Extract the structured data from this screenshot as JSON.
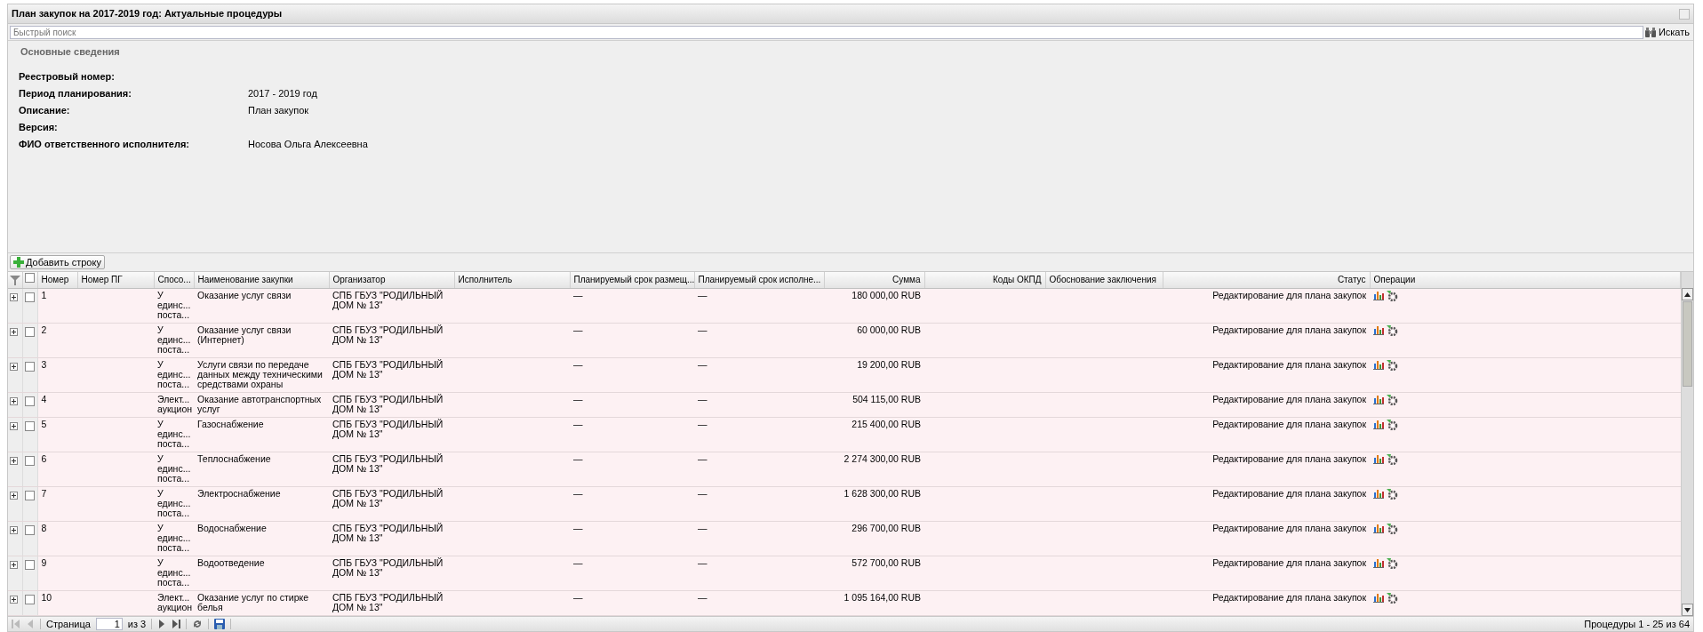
{
  "window": {
    "title": "План закупок на 2017-2019 год: Актуальные процедуры"
  },
  "search": {
    "placeholder": "Быстрый поиск",
    "button": "Искать"
  },
  "info": {
    "section": "Основные сведения",
    "fields": [
      {
        "label": "Реестровый номер:"
      },
      {
        "label": "Период планирования:",
        "value": "2017 - 2019 год"
      },
      {
        "label": "Описание:",
        "value": "План закупок"
      },
      {
        "label": "Версия:"
      },
      {
        "label": "ФИО ответственного исполнителя:",
        "value": "Носова Ольга Алексеевна"
      }
    ]
  },
  "toolbar": {
    "add_button": "Добавить строку"
  },
  "table": {
    "header_checked": false,
    "columns": [
      {
        "label": "Номер"
      },
      {
        "label": "Номер ПГ"
      },
      {
        "label": "Спосо..."
      },
      {
        "label": "Наименование закупки"
      },
      {
        "label": "Организатор"
      },
      {
        "label": "Исполнитель"
      },
      {
        "label": "Планируемый срок размещ..."
      },
      {
        "label": "Планируемый срок исполне..."
      },
      {
        "label": "Сумма"
      },
      {
        "label": "Коды ОКПД"
      },
      {
        "label": "Обоснование заключения"
      },
      {
        "label": "Статус"
      },
      {
        "label": "Операции"
      }
    ],
    "rows": [
      {
        "expanded": false,
        "checked": false,
        "number": "1",
        "method": "У единс... поста...",
        "name": "Оказание услуг связи",
        "organizer": "СПБ ГБУЗ \"РОДИЛЬНЫЙ ДОМ № 13\"",
        "placement": "—",
        "execution": "—",
        "amount": "180 000,00 RUB",
        "status": "Редактирование для плана закупок"
      },
      {
        "expanded": false,
        "checked": false,
        "number": "2",
        "method": "У единс... поста...",
        "name": "Оказание услуг связи (Интернет)",
        "organizer": "СПБ ГБУЗ \"РОДИЛЬНЫЙ ДОМ № 13\"",
        "placement": "—",
        "execution": "—",
        "amount": "60 000,00 RUB",
        "status": "Редактирование для плана закупок"
      },
      {
        "expanded": false,
        "checked": false,
        "number": "3",
        "method": "У единс... поста...",
        "name": "Услуги связи по передаче данных между техническими средствами охраны",
        "organizer": "СПБ ГБУЗ \"РОДИЛЬНЫЙ ДОМ № 13\"",
        "placement": "—",
        "execution": "—",
        "amount": "19 200,00 RUB",
        "status": "Редактирование для плана закупок"
      },
      {
        "expanded": false,
        "checked": false,
        "number": "4",
        "method": "Элект... аукцион",
        "name": "Оказание автотранспортных услуг",
        "organizer": "СПБ ГБУЗ \"РОДИЛЬНЫЙ ДОМ № 13\"",
        "placement": "—",
        "execution": "—",
        "amount": "504 115,00 RUB",
        "status": "Редактирование для плана закупок"
      },
      {
        "expanded": false,
        "checked": false,
        "number": "5",
        "method": "У единс... поста...",
        "name": "Газоснабжение",
        "organizer": "СПБ ГБУЗ \"РОДИЛЬНЫЙ ДОМ № 13\"",
        "placement": "—",
        "execution": "—",
        "amount": "215 400,00 RUB",
        "status": "Редактирование для плана закупок"
      },
      {
        "expanded": false,
        "checked": false,
        "number": "6",
        "method": "У единс... поста...",
        "name": "Теплоснабжение",
        "organizer": "СПБ ГБУЗ \"РОДИЛЬНЫЙ ДОМ № 13\"",
        "placement": "—",
        "execution": "—",
        "amount": "2 274 300,00 RUB",
        "status": "Редактирование для плана закупок"
      },
      {
        "expanded": false,
        "checked": false,
        "number": "7",
        "method": "У единс... поста...",
        "name": "Электроснабжение",
        "organizer": "СПБ ГБУЗ \"РОДИЛЬНЫЙ ДОМ № 13\"",
        "placement": "—",
        "execution": "—",
        "amount": "1 628 300,00 RUB",
        "status": "Редактирование для плана закупок"
      },
      {
        "expanded": false,
        "checked": false,
        "number": "8",
        "method": "У единс... поста...",
        "name": "Водоснабжение",
        "organizer": "СПБ ГБУЗ \"РОДИЛЬНЫЙ ДОМ № 13\"",
        "placement": "—",
        "execution": "—",
        "amount": "296 700,00 RUB",
        "status": "Редактирование для плана закупок"
      },
      {
        "expanded": false,
        "checked": false,
        "number": "9",
        "method": "У единс... поста...",
        "name": "Водоотведение",
        "organizer": "СПБ ГБУЗ \"РОДИЛЬНЫЙ ДОМ № 13\"",
        "placement": "—",
        "execution": "—",
        "amount": "572 700,00 RUB",
        "status": "Редактирование для плана закупок"
      },
      {
        "expanded": false,
        "checked": false,
        "number": "10",
        "method": "Элект... аукцион",
        "name": "Оказание услуг по стирке белья",
        "organizer": "СПБ ГБУЗ \"РОДИЛЬНЫЙ ДОМ № 13\"",
        "placement": "—",
        "execution": "—",
        "amount": "1 095 164,00 RUB",
        "status": "Редактирование для плана закупок"
      }
    ]
  },
  "pager": {
    "page_label": "Страница",
    "page": "1",
    "of": "из 3",
    "summary": "Процедуры 1 - 25 из 64"
  }
}
